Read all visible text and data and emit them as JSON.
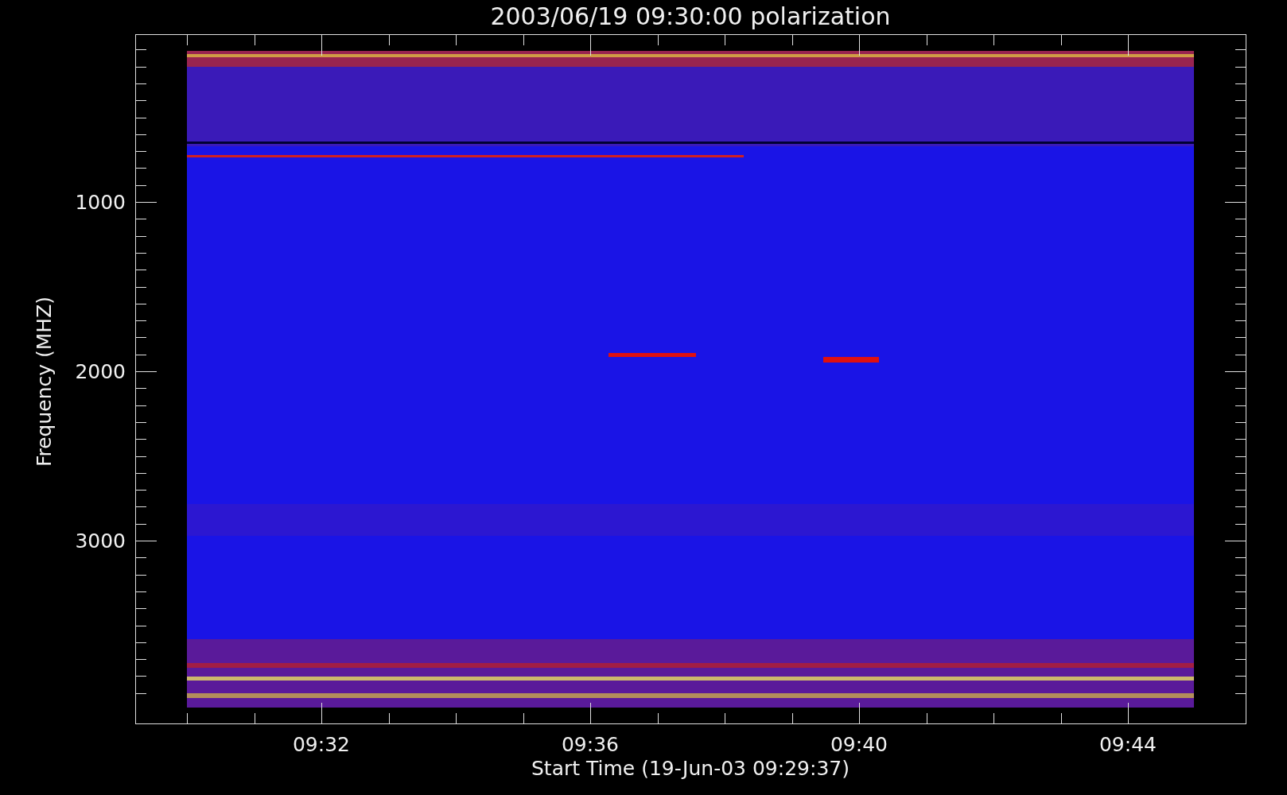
{
  "title": "2003/06/19 09:30:00 polarization",
  "y_axis": {
    "label": "Frequency (MHZ)",
    "tick_labels": [
      "1000",
      "2000",
      "3000"
    ]
  },
  "x_axis": {
    "label": "Start Time (19-Jun-03 09:29:37)",
    "tick_labels": [
      "09:32",
      "09:36",
      "09:40",
      "09:44"
    ]
  }
}
